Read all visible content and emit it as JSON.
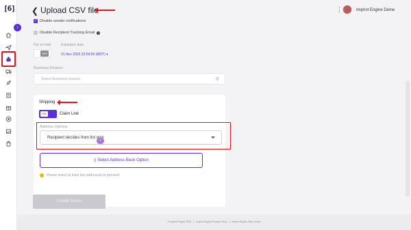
{
  "app": {
    "logo_text": "[6]",
    "user_name": "Imprint Engine Demo",
    "accent_color": "#5a2fd6",
    "annotation_color": "#e0131b"
  },
  "header": {
    "title": "Upload CSV file"
  },
  "sidebar": {
    "items": [
      {
        "icon": "home-icon"
      },
      {
        "icon": "send-icon"
      },
      {
        "icon": "gift-stack-icon",
        "active": true
      },
      {
        "icon": "truck-icon"
      },
      {
        "icon": "rocket-icon"
      },
      {
        "icon": "clipboard-icon"
      },
      {
        "icon": "gift-icon"
      },
      {
        "icon": "target-icon"
      },
      {
        "icon": "image-icon"
      },
      {
        "icon": "bag-icon"
      }
    ]
  },
  "settings": {
    "disable_sender_notifications": "Disable sender notifications",
    "disable_tracking_email": "Disable Recipient Tracking Email",
    "put_on_hold_label": "Put on hold",
    "hold_toggle_text": "OFF",
    "expiration_label": "Expiration date",
    "expiration_value": "01 Nov 2025 23:59:59 (MDT)",
    "business_reason_label": "Business Reason",
    "business_reason_placeholder": "Select business reason"
  },
  "shipping": {
    "title": "Shipping",
    "toggle_text": "ON",
    "claim_link_label": "Claim Link",
    "address_options_label": "Address Options",
    "address_option_selected": "Recipient decides from list only",
    "address_book_button": "Select Address Book Option",
    "warning_text": "Please select at least two addresses to proceed."
  },
  "actions": {
    "create_button": "Create Sends"
  },
  "footer": {
    "copyright": "© Imprint Engine 2025",
    "privacy_link": "Imprint Engine Privacy Policy",
    "help_link": "Imprint Engine Help Center",
    "separator": "|"
  }
}
